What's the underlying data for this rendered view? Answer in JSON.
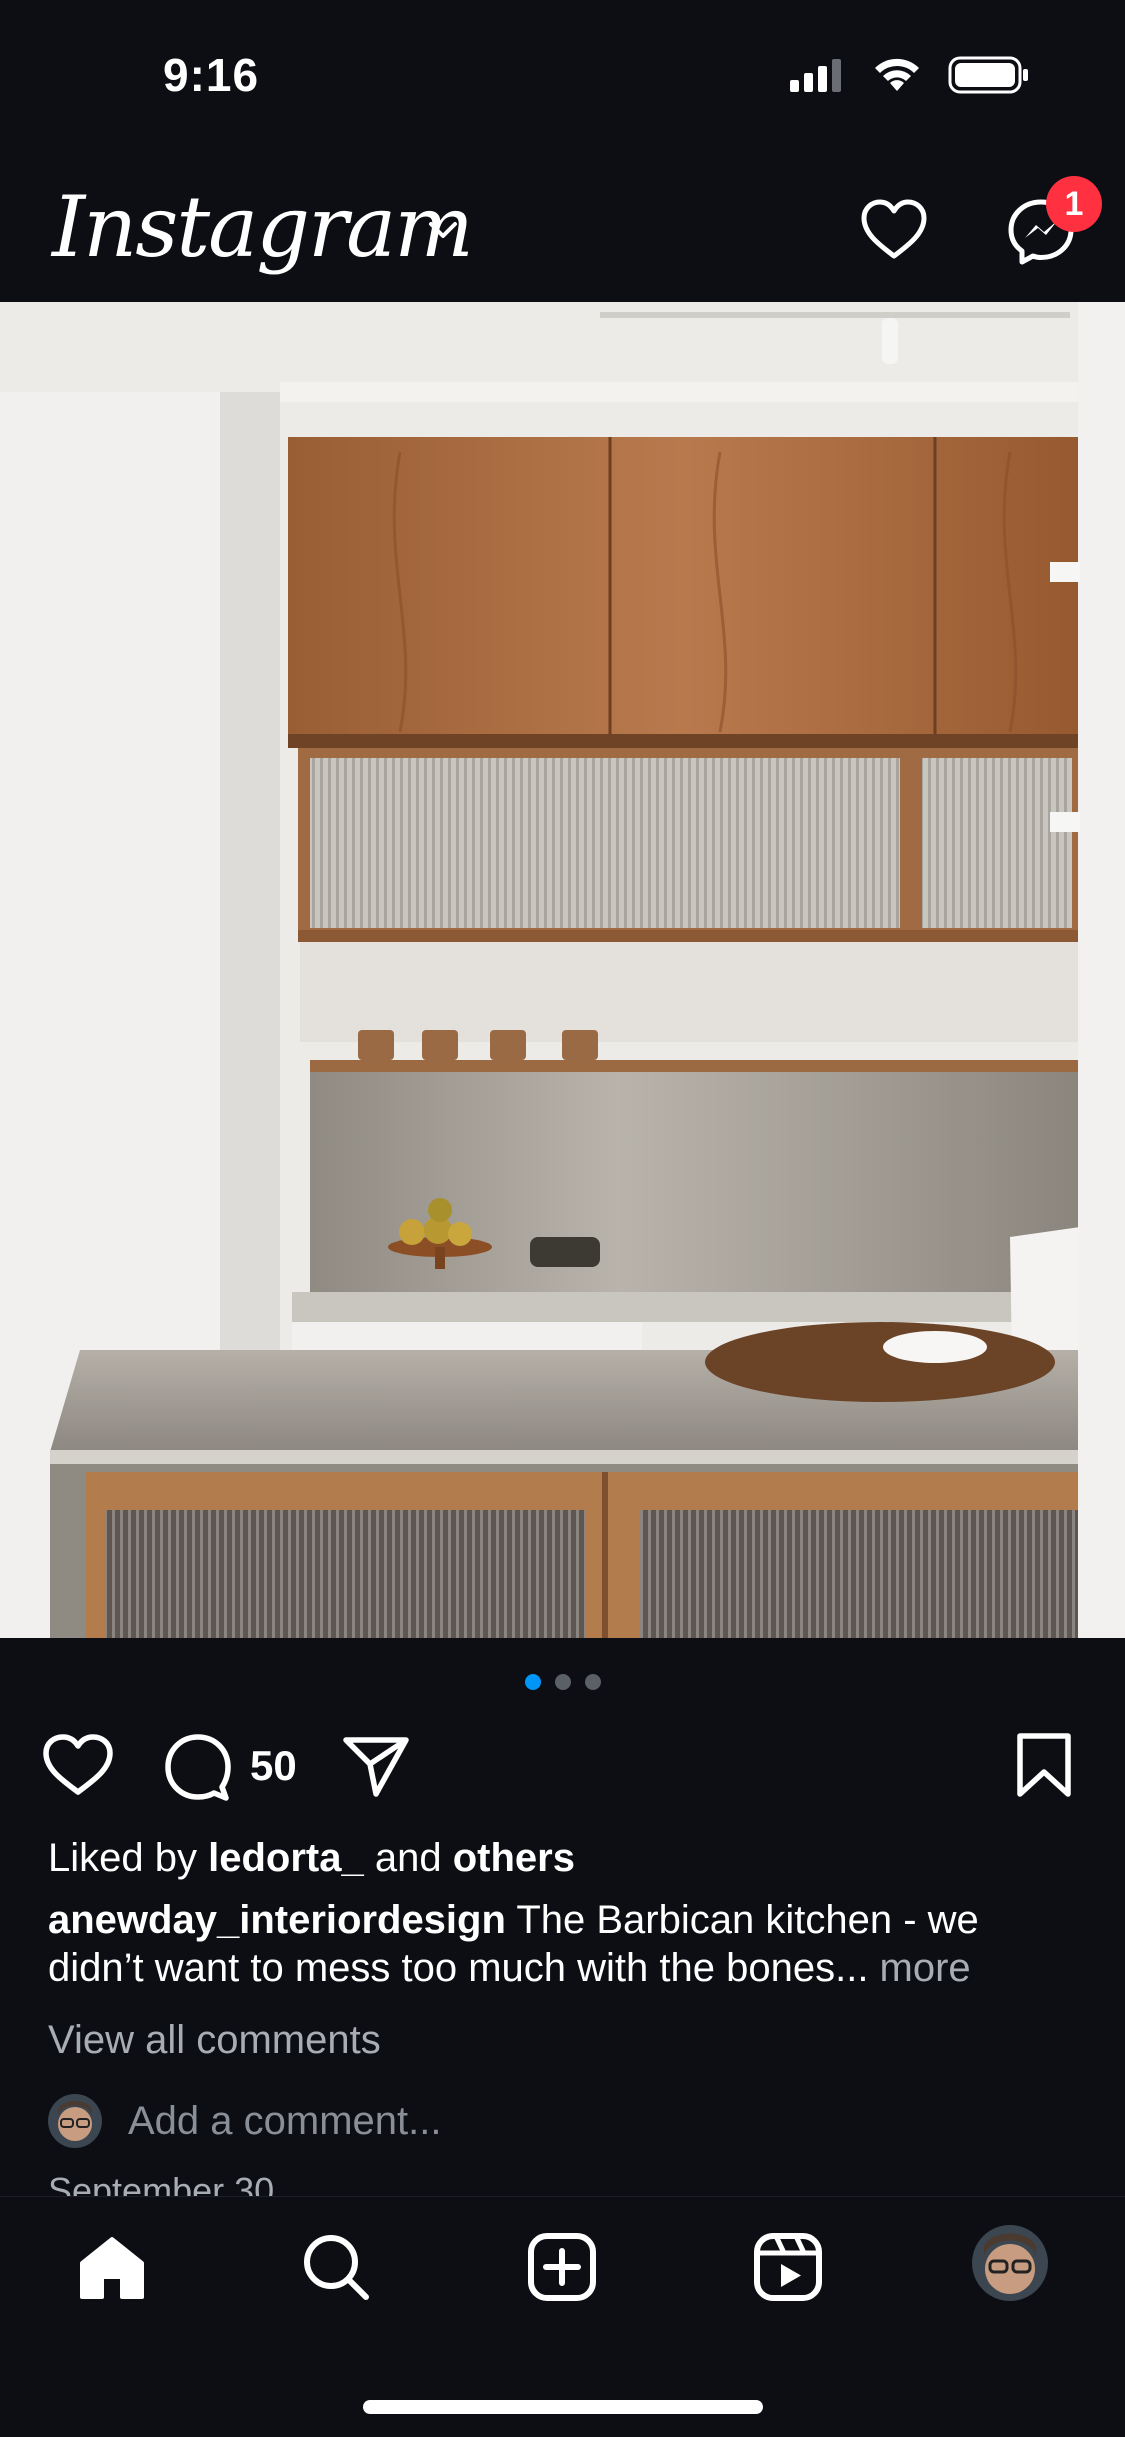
{
  "status_bar": {
    "time": "9:16"
  },
  "header": {
    "logo": "Instagram",
    "notification_badge": "1",
    "icons": [
      "chevron-down-icon",
      "heart-icon",
      "messenger-icon"
    ]
  },
  "post": {
    "image_icon": "kitchen-photo",
    "carousel": {
      "count": 3,
      "active_index": 0
    },
    "comment_count": "50",
    "liked_by_prefix": "Liked by ",
    "liked_by_user": "ledorta_",
    "liked_by_and": " and ",
    "liked_by_others": "others",
    "caption_user": "anewday_interiordesign",
    "caption_text": " The Barbican kitchen - we didn’t want to mess too much with the bones... ",
    "caption_more": "more",
    "view_comments": "View all comments",
    "add_comment_placeholder": "Add a comment...",
    "date": "September 30"
  },
  "tab_bar": {
    "items": [
      "home-icon",
      "search-icon",
      "create-icon",
      "reels-icon",
      "profile-avatar"
    ]
  },
  "colors": {
    "background": "#0c0e14",
    "badge": "#ff3040",
    "active_dot": "#0095f6",
    "secondary_text": "#a8acb3"
  }
}
